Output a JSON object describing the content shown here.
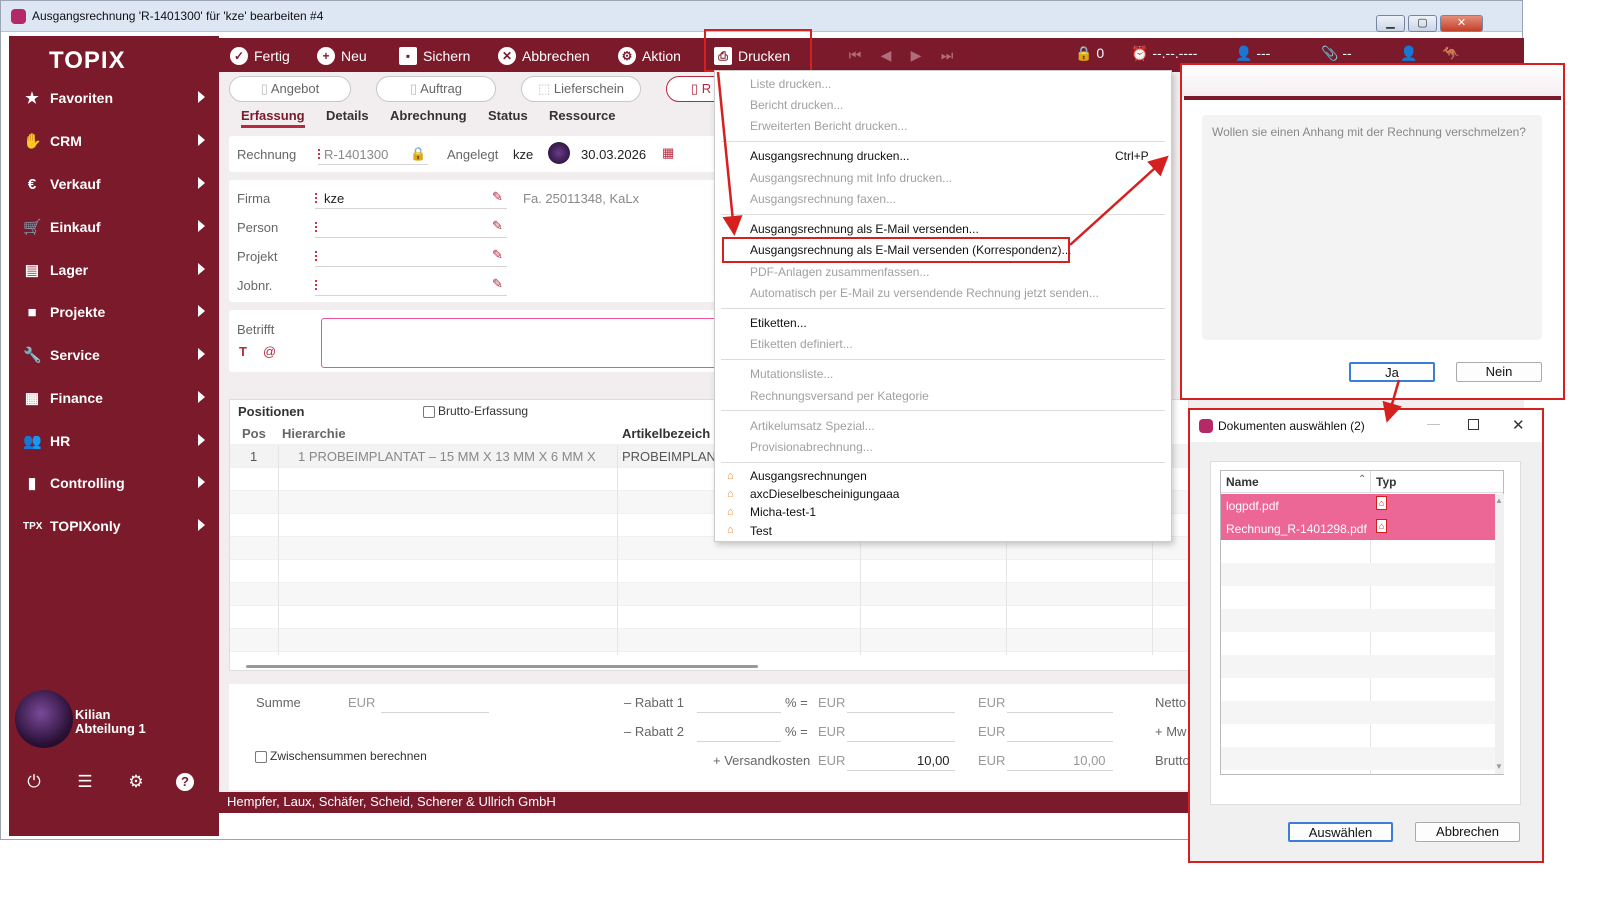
{
  "window": {
    "title": "Ausgangsrechnung 'R-1401300' für 'kze' bearbeiten #4"
  },
  "sidebar": {
    "logo": "TOPIX",
    "items": [
      {
        "label": "Favoriten",
        "icon": "star-icon"
      },
      {
        "label": "CRM",
        "icon": "handshake-icon"
      },
      {
        "label": "Verkauf",
        "icon": "euro-icon"
      },
      {
        "label": "Einkauf",
        "icon": "cart-icon"
      },
      {
        "label": "Lager",
        "icon": "warehouse-icon"
      },
      {
        "label": "Projekte",
        "icon": "folder-icon"
      },
      {
        "label": "Service",
        "icon": "wrench-icon"
      },
      {
        "label": "Finance",
        "icon": "calculator-icon"
      },
      {
        "label": "HR",
        "icon": "people-icon"
      },
      {
        "label": "Controlling",
        "icon": "bar-chart-icon"
      },
      {
        "label": "TOPIXonly",
        "icon": "tpx-icon"
      }
    ],
    "user": {
      "name": "Kilian",
      "department": "Abteilung 1"
    }
  },
  "toolbar": {
    "fertig": "Fertig",
    "neu": "Neu",
    "sichern": "Sichern",
    "abbrechen": "Abbrechen",
    "aktion": "Aktion",
    "drucken": "Drucken",
    "lock_count": "0",
    "date_placeholder": "--.--.----",
    "user_placeholder": "---",
    "clip_placeholder": "--"
  },
  "doc_tabs": {
    "angebot": "Angebot",
    "auftrag": "Auftrag",
    "lieferschein": "Lieferschein",
    "rechnung_short": "R"
  },
  "tabs": {
    "erfassung": "Erfassung",
    "details": "Details",
    "abrechnung": "Abrechnung",
    "status": "Status",
    "ressource": "Ressource"
  },
  "header": {
    "rechnung_label": "Rechnung",
    "rechnung_value": "R-1401300",
    "angelegt_label": "Angelegt",
    "angelegt_by": "kze",
    "angelegt_date": "30.03.2026"
  },
  "fields": {
    "firma_label": "Firma",
    "firma_value": "kze",
    "firma_info": "Fa. 25011348, KaLx",
    "person_label": "Person",
    "projekt_label": "Projekt",
    "jobnr_label": "Jobnr.",
    "betrifft_label": "Betrifft"
  },
  "positions": {
    "title": "Positionen",
    "brutto": "Brutto-Erfassung",
    "col_pos": "Pos",
    "col_hierarchie": "Hierarchie",
    "col_artikel": "Artikelbezeich",
    "row1_pos": "1",
    "row1_hier": "1 PROBEIMPLANTAT – 15 MM X 13 MM X 6 MM X",
    "row1_art": "PROBEIMPLANT"
  },
  "totals": {
    "summe": "Summe",
    "eur": "EUR",
    "rabatt1": "– Rabatt 1",
    "rabatt2": "– Rabatt 2",
    "percent_eq": "% =",
    "versand": "+ Versandkosten",
    "versand_val": "10,00",
    "versand_val2": "10,00",
    "zwischensummen": "Zwischensummen berechnen",
    "netto": "Netto",
    "mw": "+ Mw",
    "brutto": "Brutto"
  },
  "footer": {
    "company": "Hempfer, Laux, Schäfer, Scheid, Scherer & Ullrich GmbH"
  },
  "menu": {
    "items": [
      {
        "label": "Liste drucken...",
        "disabled": true
      },
      {
        "label": "Bericht drucken...",
        "disabled": true
      },
      {
        "label": "Erweiterten Bericht drucken...",
        "disabled": true
      },
      {
        "label": "Ausgangsrechnung drucken...",
        "disabled": false,
        "shortcut": "Ctrl+P"
      },
      {
        "label": "Ausgangsrechnung mit Info drucken...",
        "disabled": true
      },
      {
        "label": "Ausgangsrechnung faxen...",
        "disabled": true
      },
      {
        "label": "Ausgangsrechnung als E-Mail versenden...",
        "disabled": false
      },
      {
        "label": "Ausgangsrechnung als E-Mail versenden (Korrespondenz)...",
        "disabled": false
      },
      {
        "label": "PDF-Anlagen zusammenfassen...",
        "disabled": true
      },
      {
        "label": "Automatisch per E-Mail zu versendende Rechnung jetzt senden...",
        "disabled": true
      },
      {
        "label": "Etiketten...",
        "disabled": false
      },
      {
        "label": "Etiketten definiert...",
        "disabled": true
      },
      {
        "label": "Mutationsliste...",
        "disabled": true
      },
      {
        "label": "Rechnungsversand per Kategorie",
        "disabled": true
      },
      {
        "label": "Artikelumsatz Spezial...",
        "disabled": true
      },
      {
        "label": "Provisionabrechnung...",
        "disabled": true
      },
      {
        "label": "Ausgangsrechnungen",
        "disabled": false
      },
      {
        "label": "axcDieselbescheinigungaaa",
        "disabled": false
      },
      {
        "label": "Micha-test-1",
        "disabled": false
      },
      {
        "label": "Test",
        "disabled": false
      }
    ]
  },
  "dialog_merge": {
    "question": "Wollen sie einen Anhang mit der Rechnung verschmelzen?",
    "yes": "Ja",
    "no": "Nein"
  },
  "dialog_docs": {
    "title": "Dokumenten auswählen (2)",
    "col_name": "Name",
    "col_type": "Typ",
    "rows": [
      "logpdf.pdf",
      "Rechnung_R-1401298.pdf"
    ],
    "select": "Auswählen",
    "cancel": "Abbrechen"
  }
}
